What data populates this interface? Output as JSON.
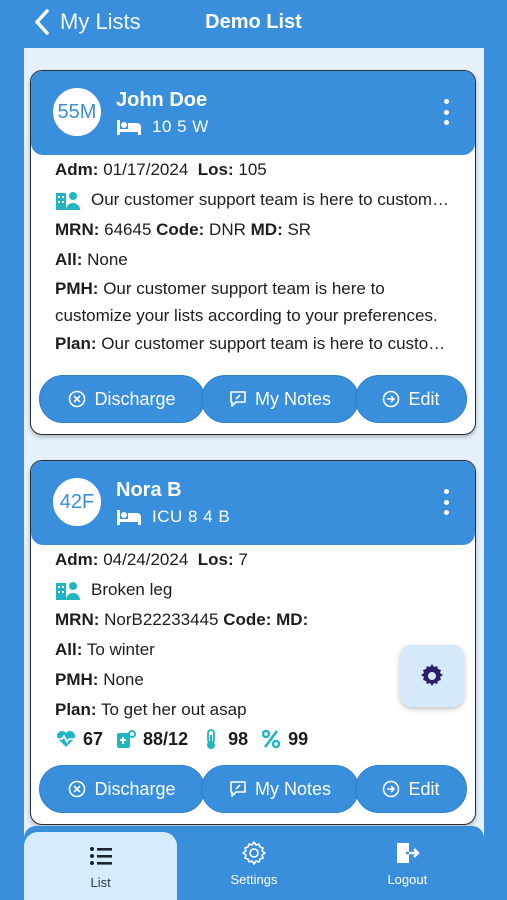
{
  "header": {
    "back_label": "My Lists",
    "title": "Demo List"
  },
  "patients": [
    {
      "avatar": "55M",
      "name": "John Doe",
      "bed": "10  5  W",
      "adm_label": "Adm:",
      "adm": "01/17/2024",
      "los_label": "Los:",
      "los": "105",
      "department": "Our customer support team is here to customize your lists according to your preferences.",
      "mrn_label": "MRN:",
      "mrn": "64645",
      "code_label": "Code:",
      "code": "DNR",
      "md_label": "MD:",
      "md": "SR",
      "all_label": "All:",
      "allergies": "None",
      "pmh_label": "PMH:",
      "pmh": "Our customer support team is here to customize your lists according to your preferences.",
      "plan_label": "Plan:",
      "plan": "Our customer support team is here to customize your lists according to your preferences."
    },
    {
      "avatar": "42F",
      "name": "Nora B",
      "bed": "ICU  8  4  B",
      "adm_label": "Adm:",
      "adm": "04/24/2024",
      "los_label": "Los:",
      "los": "7",
      "department": "Broken leg",
      "mrn_label": "MRN:",
      "mrn": "NorB22233445",
      "code_label": "Code:",
      "code": "",
      "md_label": "MD:",
      "md": "",
      "all_label": "All:",
      "allergies": "To winter",
      "pmh_label": "PMH:",
      "pmh": "None",
      "plan_label": "Plan:",
      "plan": "To get her out asap",
      "vitals": {
        "heart_rate": "67",
        "blood_pressure": "88/12",
        "temperature": "98",
        "spo2": "99"
      }
    }
  ],
  "actions": {
    "discharge": "Discharge",
    "notes": "My Notes",
    "edit": "Edit"
  },
  "tabs": {
    "list": "List",
    "settings": "Settings",
    "logout": "Logout"
  },
  "colors": {
    "primary": "#3a8fdc",
    "panel": "#e6f1fc",
    "icon_teal": "#1fb6c1",
    "fab_icon": "#2a1f6b"
  }
}
